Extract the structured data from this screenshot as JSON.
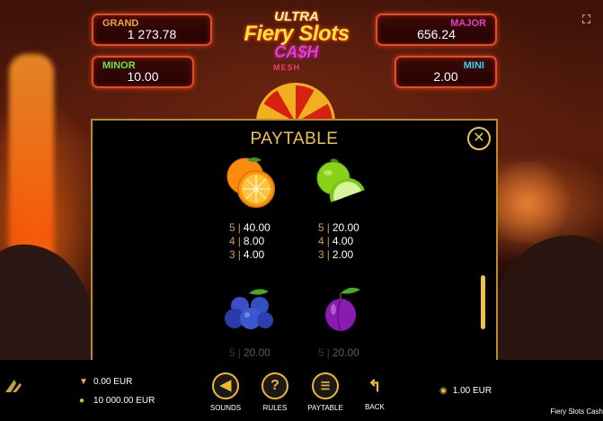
{
  "game": {
    "logo": {
      "line1": "ULTRA",
      "line2": "Fiery Slots",
      "line3": "CA$H",
      "line4": "MESH"
    },
    "name_footer": "Fiery Slots Cash"
  },
  "jackpots": {
    "grand": {
      "label": "GRAND",
      "value": "1 273.78",
      "color": "#f0a43a"
    },
    "major": {
      "label": "MAJOR",
      "value": "656.24",
      "color": "#e83cc6"
    },
    "minor": {
      "label": "MINOR",
      "value": "10.00",
      "color": "#6ee83a"
    },
    "mini": {
      "label": "MINI",
      "value": "2.00",
      "color": "#3ad2f0"
    }
  },
  "paytable": {
    "title": "PAYTABLE",
    "close_icon": "close-icon",
    "symbols": [
      {
        "name": "orange",
        "pays": [
          {
            "n": "5",
            "v": "40.00"
          },
          {
            "n": "4",
            "v": "8.00"
          },
          {
            "n": "3",
            "v": "4.00"
          }
        ]
      },
      {
        "name": "lime",
        "pays": [
          {
            "n": "5",
            "v": "20.00"
          },
          {
            "n": "4",
            "v": "4.00"
          },
          {
            "n": "3",
            "v": "2.00"
          }
        ]
      },
      {
        "name": "blueberries",
        "pays": [
          {
            "n": "5",
            "v": "20.00"
          }
        ]
      },
      {
        "name": "plum",
        "pays": [
          {
            "n": "5",
            "v": "20.00"
          }
        ]
      }
    ]
  },
  "balances": {
    "win": "0.00 EUR",
    "balance": "10 000.00 EUR"
  },
  "controls": {
    "sounds": "SOUNDS",
    "rules": "RULES",
    "paytable": "PAYTABLE",
    "back": "BACK"
  },
  "bet": {
    "value": "1.00 EUR"
  }
}
